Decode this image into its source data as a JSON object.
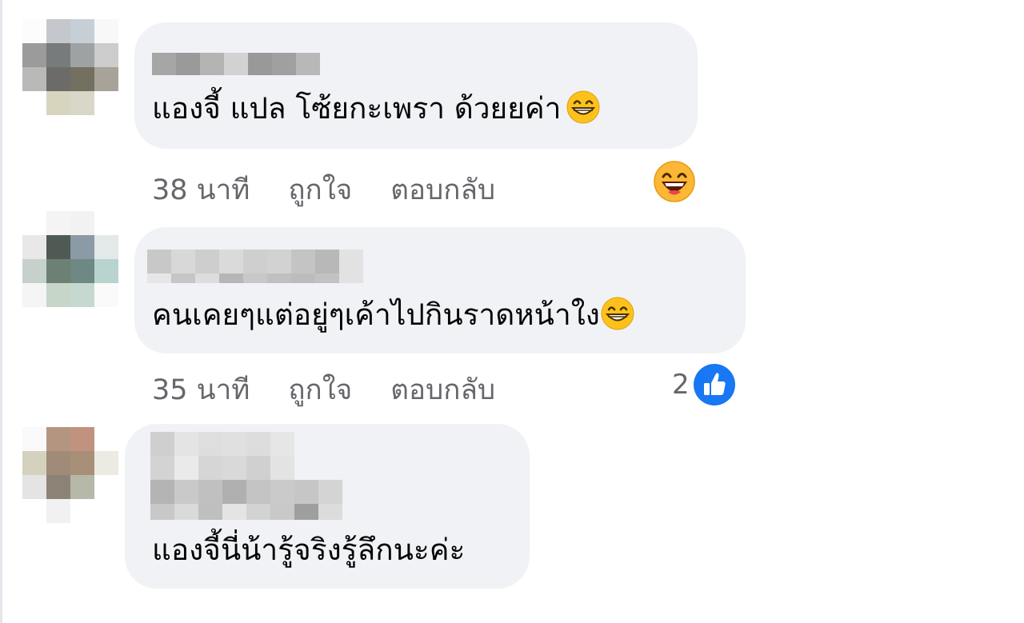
{
  "top_fragment": "ู",
  "comments": [
    {
      "text": "แองจี้ แปล โซ้ยกะเพรา ด้วยยค่า",
      "inline_emoji": "grinning-smile",
      "time": "38 นาที",
      "like_label": "ถูกใจ",
      "reply_label": "ตอบกลับ",
      "reaction": "laughing-face"
    },
    {
      "text": "คนเคยๆแต่อยู่ๆเค้าไปกินราดหน้าใง",
      "inline_emoji": "grinning-smile",
      "time": "35 นาที",
      "like_label": "ถูกใจ",
      "reply_label": "ตอบกลับ",
      "reaction": "like-thumbs-up",
      "reaction_count": "2"
    },
    {
      "text": "แองจี้นี่น้ารู้จริงรู้ลึกนะค่ะ"
    }
  ],
  "colors": {
    "bubble": "#f0f2f5",
    "text": "#050505",
    "secondary_text": "#65676b",
    "like_blue": "#1877f2",
    "emoji_yellow": "#fcc21b"
  }
}
